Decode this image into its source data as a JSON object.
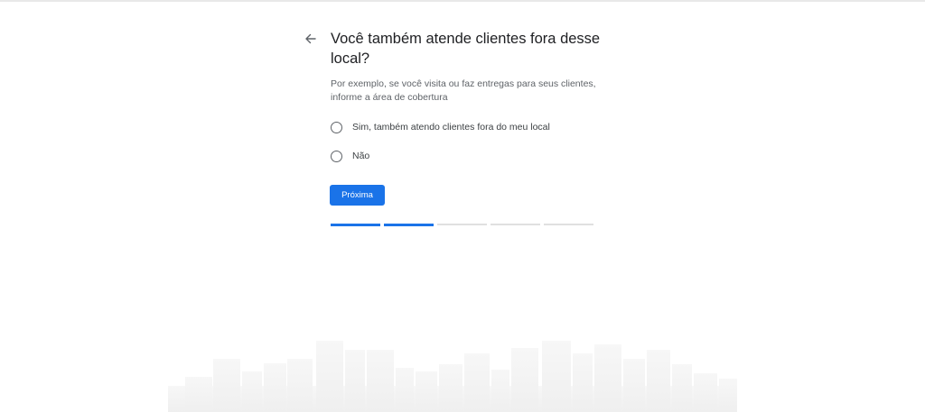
{
  "question": {
    "title": "Você também atende clientes fora desse local?",
    "description": "Por exemplo, se você visita ou faz entregas para seus clientes, informe a área de cobertura"
  },
  "options": [
    {
      "label": "Sim, também atendo clientes fora do meu local",
      "selected": false
    },
    {
      "label": "Não",
      "selected": false
    }
  ],
  "actions": {
    "next_label": "Próxima"
  },
  "progress": {
    "total_steps": 5,
    "completed_steps": 2
  },
  "colors": {
    "accent": "#1a73e8",
    "title_text": "#202124",
    "secondary_text": "#5f6368",
    "progress_track": "#e0e0e0",
    "skyline": "#f3f3f3"
  },
  "icons": {
    "back": "arrow-left-icon"
  }
}
